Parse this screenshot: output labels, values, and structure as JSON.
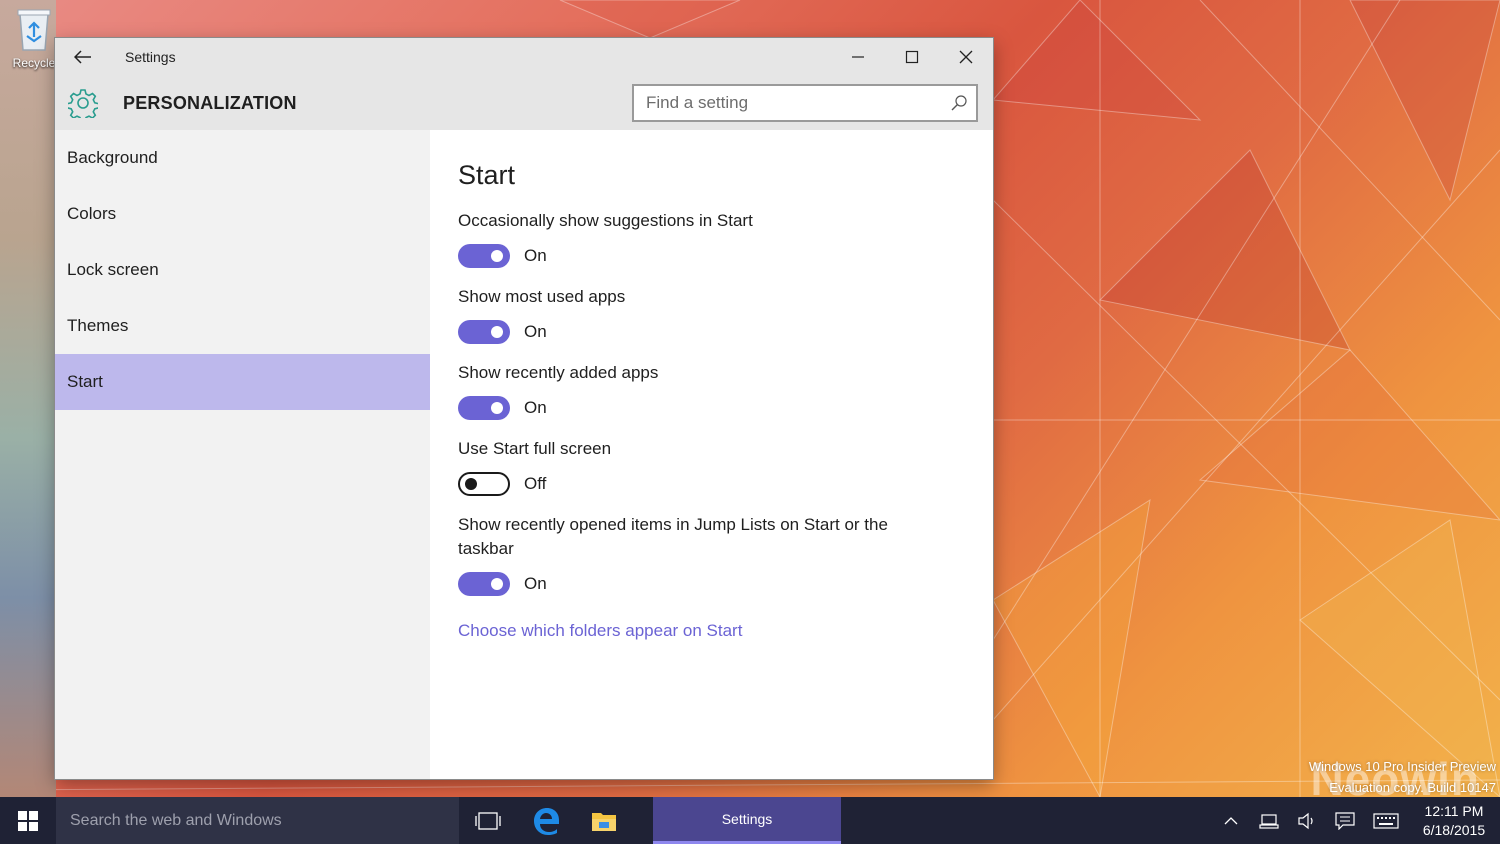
{
  "desktop": {
    "recycle_label": "Recycle",
    "watermark_line1": "Windows 10 Pro Insider Preview",
    "watermark_line2": "Evaluation copy. Build 10147",
    "watermark_logo": "Neowin"
  },
  "window": {
    "title": "Settings",
    "section": "PERSONALIZATION",
    "search_placeholder": "Find a setting",
    "icons": [
      "back-arrow-icon",
      "minimize-icon",
      "maximize-icon",
      "close-icon",
      "gear-icon",
      "search-icon"
    ]
  },
  "sidebar": {
    "items": [
      {
        "label": "Background"
      },
      {
        "label": "Colors"
      },
      {
        "label": "Lock screen"
      },
      {
        "label": "Themes"
      },
      {
        "label": "Start",
        "active": true
      }
    ]
  },
  "content": {
    "heading": "Start",
    "settings": [
      {
        "label": "Occasionally show suggestions in Start",
        "state": "On"
      },
      {
        "label": "Show most used apps",
        "state": "On"
      },
      {
        "label": "Show recently added apps",
        "state": "On"
      },
      {
        "label": "Use Start full screen",
        "state": "Off"
      },
      {
        "label": "Show recently opened items in Jump Lists on Start or the taskbar",
        "state": "On"
      }
    ],
    "link": "Choose which folders appear on Start"
  },
  "taskbar": {
    "search_placeholder": "Search the web and Windows",
    "active_app": "Settings",
    "time": "12:11 PM",
    "date": "6/18/2015",
    "icons": [
      "windows-start-icon",
      "task-view-icon",
      "edge-icon",
      "file-explorer-icon",
      "chevron-up-icon",
      "network-icon",
      "volume-icon",
      "action-center-icon",
      "keyboard-icon"
    ]
  },
  "colors": {
    "accent": "#6b63d4",
    "active_nav": "#bdb8ec",
    "taskbar": "#1f2235"
  }
}
